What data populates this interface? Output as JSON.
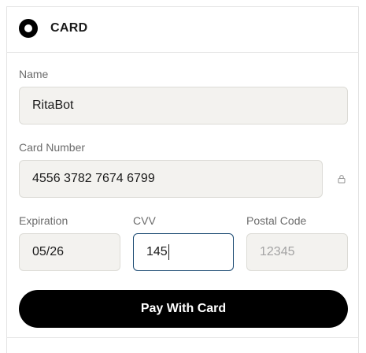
{
  "payment_method": {
    "title": "CARD",
    "selected": true
  },
  "fields": {
    "name": {
      "label": "Name",
      "value": "RitaBot"
    },
    "card_number": {
      "label": "Card Number",
      "value": "4556 3782 7674 6799"
    },
    "expiration": {
      "label": "Expiration",
      "value": "05/26"
    },
    "cvv": {
      "label": "CVV",
      "value": "145"
    },
    "postal_code": {
      "label": "Postal Code",
      "placeholder": "12345"
    }
  },
  "icons": {
    "card_lock": "lock-icon"
  },
  "pay_button": {
    "label": "Pay With Card"
  },
  "colors": {
    "button_bg": "#000000",
    "field_bg": "#f3f2ef",
    "focus_border": "#1c4a73"
  }
}
